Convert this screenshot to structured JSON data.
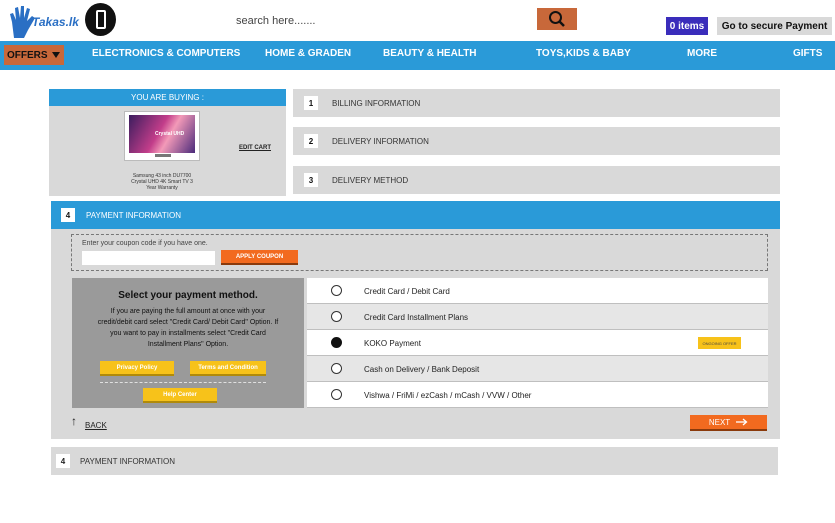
{
  "header": {
    "logo_text": "Takas.lk",
    "search_placeholder": "search here.......",
    "cart_items": "0 items",
    "secure_payment": "Go to secure Payment"
  },
  "nav": {
    "offers": "OFFERS",
    "items": [
      "ELECTRONICS & COMPUTERS",
      "HOME & GRADEN",
      "BEAUTY & HEALTH",
      "TOYS,KIDS & BABY",
      "MORE",
      "GIFTS"
    ]
  },
  "buying": {
    "heading": "YOU ARE BUYING :",
    "edit_cart": "EDIT CART",
    "product_line1": "Samsung 43 inch DU7700",
    "product_line2": "Crystal UHD 4K Smart TV 3",
    "product_line3": "Year Warranty",
    "screen_text": "Crystal UHD"
  },
  "steps": [
    {
      "num": "1",
      "label": "BILLING INFORMATION"
    },
    {
      "num": "2",
      "label": "DELIVERY INFORMATION"
    },
    {
      "num": "3",
      "label": "DELIVERY METHOD"
    }
  ],
  "payment": {
    "num": "4",
    "label": "PAYMENT INFORMATION",
    "coupon_hint": "Enter your coupon code if you have one.",
    "coupon_value": "",
    "apply_coupon": "APPLY COUPON",
    "method_title": "Select your payment method.",
    "method_desc": "If you are paying the full amount at once with your credit/debit card select \"Credit Card/ Debit Card\" Option. If you want to pay in installments select \"Credit Card Installment Plans\" Option.",
    "privacy_policy": "Privacy Policy",
    "terms": "Terms and Condition",
    "help_center": "Help Center",
    "options": [
      {
        "label": "Credit Card / Debit Card",
        "selected": false
      },
      {
        "label": "Credit Card Installment Plans",
        "selected": false
      },
      {
        "label": "KOKO Payment",
        "selected": true,
        "badge": "ONGOING OFFER"
      },
      {
        "label": "Cash on Delivery / Bank Deposit",
        "selected": false
      },
      {
        "label": "Vishwa / FriMi / ezCash / mCash / VVW / Other",
        "selected": false
      }
    ],
    "back": "BACK",
    "next": "NEXT"
  },
  "footer_step": {
    "num": "4",
    "label": "PAYMENT INFORMATION"
  },
  "colors": {
    "accent_blue": "#2a9ad8",
    "orange": "#f26a1f",
    "yellow": "#f7c21a",
    "cart_purple": "#3a2dbb"
  }
}
